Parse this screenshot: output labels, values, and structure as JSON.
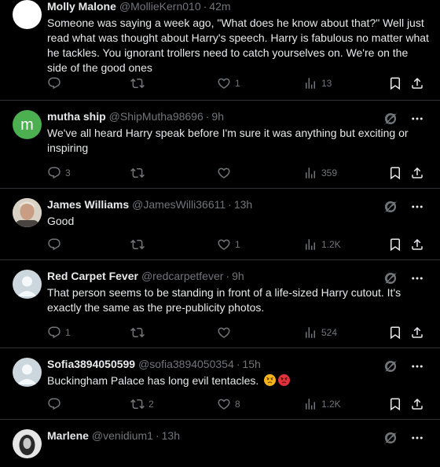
{
  "tweets": [
    {
      "name": "Molly Malone",
      "handle": "@MollieKern010",
      "time": "42m",
      "text": "Someone was saying a week ago, \"What does he know about that?\" Well just read what was thought about Harry's speech. Harry is fabulous no matter what he tackles.  You ignorant trollers need to catch yourselves on. We're on the side of the good ones",
      "replies": "",
      "retweets": "",
      "likes": "1",
      "views": "13",
      "avatar": "white"
    },
    {
      "name": "mutha ship",
      "handle": "@ShipMutha98696",
      "time": "9h",
      "text": "We've all heard Harry speak before I'm sure it was anything but exciting or inspiring",
      "replies": "3",
      "retweets": "",
      "likes": "",
      "views": "359",
      "avatar_letter": "m",
      "avatar_color": "#4caf50"
    },
    {
      "name": "James Williams",
      "handle": "@JamesWilli36611",
      "time": "13h",
      "text": "Good",
      "replies": "",
      "retweets": "",
      "likes": "1",
      "views": "1.2K",
      "avatar": "photo"
    },
    {
      "name": "Red Carpet Fever",
      "handle": "@redcarpetfever",
      "time": "9h",
      "text": "That person seems to be standing in front of a life-sized Harry cutout. It's exactly the same as the pre-publicity photos.",
      "replies": "1",
      "retweets": "",
      "likes": "",
      "views": "524",
      "avatar": "default"
    },
    {
      "name": "Sofia3894050599",
      "handle": "@sofia3894050354",
      "time": "15h",
      "text": "Buckingham Palace has long evil tentacles.",
      "emojis": [
        "angry-face",
        "pouting-face"
      ],
      "replies": "",
      "retweets": "2",
      "likes": "8",
      "views": "1.2K",
      "avatar": "default"
    },
    {
      "name": "Marlene",
      "handle": "@venidium1",
      "time": "13h",
      "avatar": "dark-photo"
    }
  ],
  "separator": "·",
  "colors": {
    "background": "#000000",
    "text": "#e7e9ea",
    "muted": "#71767b",
    "border": "#2f3336"
  },
  "icons": [
    "reply-icon",
    "retweet-icon",
    "like-icon",
    "views-icon",
    "bookmark-icon",
    "share-icon",
    "grok-icon",
    "more-icon"
  ]
}
